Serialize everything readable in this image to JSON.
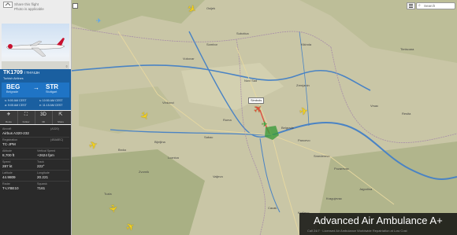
{
  "panel": {
    "share_text": "Share this flight",
    "header_text": "Photo is applicable",
    "photo_credit": "©",
    "flight_number": "TK1709",
    "flight_suffix": "/ THY4JH",
    "airline": "Turkish Airlines",
    "origin_iata": "BEG",
    "origin_city": "Belgrade",
    "dest_iata": "STR",
    "dest_city": "Stuttgart",
    "arrow": "→",
    "sched_dep": "s: 9:00 AM CEST",
    "actual_dep": "a: 9:05 AM CEST",
    "sched_arr": "s: 10:50 AM CEST",
    "est_arr": "e: 11:15 AM CEST"
  },
  "toolbar": {
    "buttons": [
      {
        "icon": "✈",
        "label": "Route"
      },
      {
        "icon": "⛶",
        "label": "Follow"
      },
      {
        "icon": "3D",
        "label": "3D"
      },
      {
        "icon": "⇱",
        "label": "Share"
      }
    ]
  },
  "details": {
    "aircraft_label": "Aircraft",
    "aircraft_value": "Airbus A320-232",
    "aircraft_code": "(A320)",
    "registration_label": "Registration",
    "registration_value": "TC-JPM",
    "reg_extra": "(4BA8EC)",
    "altitude_label": "Altitude",
    "altitude_value": "8,700 ft",
    "vspeed_label": "Vertical Speed",
    "vspeed_value": "+2624 fpm",
    "speed_label": "Speed",
    "speed_value": "287 kt",
    "track_label": "Track",
    "track_value": "222°",
    "lat_label": "Latitude",
    "lat_value": "44.9809",
    "lon_label": "Longitude",
    "lon_value": "20.221",
    "radar_label": "Radar",
    "radar_value": "T-LYBE10",
    "squawk_label": "Squawk",
    "squawk_value": "7161"
  },
  "map": {
    "callout_label": "Simbols",
    "search_placeholder": "Search",
    "cities": [
      "Osijek",
      "Vukovar",
      "Subotica",
      "Sombor",
      "Novi Sad",
      "Zrenjanin",
      "Belgrade",
      "Pancevo",
      "Ruma",
      "Sabac",
      "Loznica",
      "Valjevo",
      "Smederevo",
      "Pozarevac",
      "Timisoara",
      "Resita",
      "Vrsac",
      "Kikinda",
      "Vinkovci",
      "Brcko",
      "Tuzla",
      "Bijeljina",
      "Zvornik",
      "Kragujevac",
      "Cacak",
      "Jagodina",
      "Kraljevo"
    ]
  },
  "watermark": {
    "title": "Advanced Air Ambulance A+",
    "subtitle": "Call 24/7 · Licensed Air Ambulance Worldwide Repatriation at Low Cost"
  },
  "colors": {
    "panel_blue": "#1a5fa0",
    "route_box": "#1f74c5",
    "plane_yellow": "#f4d21e",
    "map_land": "#c9c6a6",
    "river": "#4a83c4"
  }
}
